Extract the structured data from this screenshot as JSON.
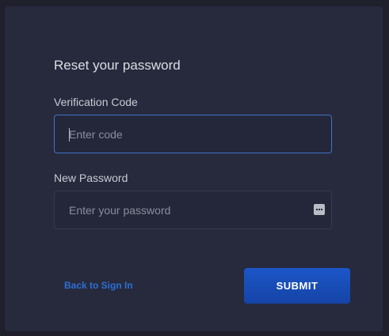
{
  "form": {
    "title": "Reset your password",
    "verification_code": {
      "label": "Verification Code",
      "placeholder": "Enter code",
      "value": ""
    },
    "new_password": {
      "label": "New Password",
      "placeholder": "Enter your password",
      "value": ""
    },
    "back_link": "Back to Sign In",
    "submit_label": "SUBMIT"
  },
  "icons": {
    "password_toggle": "password-manager-icon"
  },
  "colors": {
    "background": "#1f202c",
    "card": "#272a3d",
    "accent": "#1b56c8",
    "focus_border": "#3f72c6",
    "link": "#2c6fd6"
  }
}
